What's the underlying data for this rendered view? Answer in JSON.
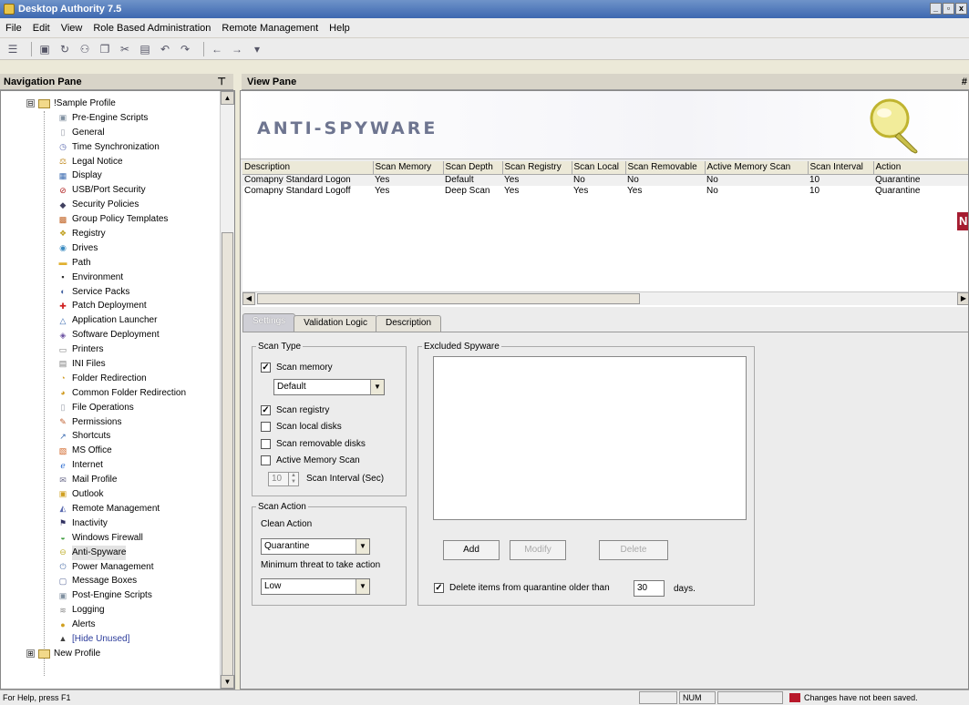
{
  "window": {
    "title": "Desktop Authority 7.5",
    "controls": [
      "_",
      "▫",
      "x"
    ]
  },
  "menu": [
    "File",
    "Edit",
    "View",
    "Role Based Administration",
    "Remote Management",
    "Help"
  ],
  "toolbar": {
    "icons": [
      "properties-icon",
      "save-icon",
      "refresh-icon",
      "users-icon",
      "copy-icon",
      "cut-icon",
      "paste-icon",
      "undo-icon",
      "redo-icon",
      "back-icon",
      "forward-icon"
    ]
  },
  "nav": {
    "header": "Navigation Pane",
    "pin": "⊤",
    "root": {
      "expander": "⊟",
      "label": "!Sample Profile"
    },
    "items": [
      {
        "label": "Pre-Engine Scripts",
        "icon": "script-icon",
        "glyph": "▣",
        "color": "#8090a0"
      },
      {
        "label": "General",
        "icon": "general-icon",
        "glyph": "▯",
        "color": "#9aa0aa"
      },
      {
        "label": "Time Synchronization",
        "icon": "clock-icon",
        "glyph": "◷",
        "color": "#5a6ab0"
      },
      {
        "label": "Legal Notice",
        "icon": "legal-icon",
        "glyph": "⚖",
        "color": "#c08a20"
      },
      {
        "label": "Display",
        "icon": "display-icon",
        "glyph": "▦",
        "color": "#3a6ab0"
      },
      {
        "label": "USB/Port Security",
        "icon": "usb-security-icon",
        "glyph": "⊘",
        "color": "#b02020"
      },
      {
        "label": "Security Policies",
        "icon": "security-policies-icon",
        "glyph": "◆",
        "color": "#404060"
      },
      {
        "label": "Group Policy Templates",
        "icon": "group-policy-icon",
        "glyph": "▩",
        "color": "#c06020"
      },
      {
        "label": "Registry",
        "icon": "registry-icon",
        "glyph": "❖",
        "color": "#c0a020"
      },
      {
        "label": "Drives",
        "icon": "drives-icon",
        "glyph": "◉",
        "color": "#3a8ac0"
      },
      {
        "label": "Path",
        "icon": "path-icon",
        "glyph": "▬",
        "color": "#e0b030"
      },
      {
        "label": "Environment",
        "icon": "environment-icon",
        "glyph": "▪",
        "color": "#303030"
      },
      {
        "label": "Service Packs",
        "icon": "service-packs-icon",
        "glyph": "◐",
        "color": "#4060a0"
      },
      {
        "label": "Patch Deployment",
        "icon": "patch-icon",
        "glyph": "✚",
        "color": "#d02020"
      },
      {
        "label": "Application Launcher",
        "icon": "launcher-icon",
        "glyph": "△",
        "color": "#3a6ab0"
      },
      {
        "label": "Software Deployment",
        "icon": "software-icon",
        "glyph": "◈",
        "color": "#6a50a0"
      },
      {
        "label": "Printers",
        "icon": "printer-icon",
        "glyph": "▭",
        "color": "#7a7a7a"
      },
      {
        "label": "INI Files",
        "icon": "ini-icon",
        "glyph": "▤",
        "color": "#7a7a7a"
      },
      {
        "label": "Folder Redirection",
        "icon": "folder-redirection-icon",
        "glyph": "◔",
        "color": "#d09a20"
      },
      {
        "label": "Common Folder Redirection",
        "icon": "common-folder-icon",
        "glyph": "◕",
        "color": "#d09a20"
      },
      {
        "label": "File Operations",
        "icon": "file-operations-icon",
        "glyph": "▯",
        "color": "#9aa0aa"
      },
      {
        "label": "Permissions",
        "icon": "permissions-icon",
        "glyph": "✎",
        "color": "#c06030"
      },
      {
        "label": "Shortcuts",
        "icon": "shortcuts-icon",
        "glyph": "↗",
        "color": "#3a6ab0"
      },
      {
        "label": "MS Office",
        "icon": "office-icon",
        "glyph": "▧",
        "color": "#d06020"
      },
      {
        "label": "Internet",
        "icon": "internet-icon",
        "glyph": "ℯ",
        "color": "#2a6ad0"
      },
      {
        "label": "Mail Profile",
        "icon": "mail-profile-icon",
        "glyph": "✉",
        "color": "#6a6a8a"
      },
      {
        "label": "Outlook",
        "icon": "outlook-icon",
        "glyph": "▣",
        "color": "#d0a020"
      },
      {
        "label": "Remote Management",
        "icon": "remote-management-icon",
        "glyph": "◭",
        "color": "#5a6ab0"
      },
      {
        "label": "Inactivity",
        "icon": "inactivity-icon",
        "glyph": "⚑",
        "color": "#303060"
      },
      {
        "label": "Windows Firewall",
        "icon": "firewall-icon",
        "glyph": "◒",
        "color": "#3a9a3a"
      },
      {
        "label": "Anti-Spyware",
        "icon": "anti-spyware-icon",
        "glyph": "⊖",
        "color": "#c0b030",
        "selected": true
      },
      {
        "label": "Power Management",
        "icon": "power-icon",
        "glyph": "⏻",
        "color": "#5a7ab0"
      },
      {
        "label": "Message Boxes",
        "icon": "message-boxes-icon",
        "glyph": "▢",
        "color": "#5a6a9a"
      },
      {
        "label": "Post-Engine Scripts",
        "icon": "script-icon",
        "glyph": "▣",
        "color": "#8090a0"
      },
      {
        "label": "Logging",
        "icon": "logging-icon",
        "glyph": "≋",
        "color": "#8a8a8a"
      },
      {
        "label": "Alerts",
        "icon": "alerts-icon",
        "glyph": "●",
        "color": "#d0a020"
      },
      {
        "label": "[Hide Unused]",
        "icon": "hide-unused-icon",
        "glyph": "▲",
        "color": "#404040",
        "blue": true
      }
    ],
    "second_root": {
      "expander": "⊞",
      "label": "New Profile"
    }
  },
  "view": {
    "header": "View Pane",
    "pin": "#",
    "banner_title": "ANTI-SPYWARE",
    "grid": {
      "columns": [
        "Description",
        "Scan Memory",
        "Scan Depth",
        "Scan Registry",
        "Scan Local",
        "Scan Removable",
        "Active Memory Scan",
        "Scan Interval",
        "Action"
      ],
      "rows": [
        [
          "Comapny Standard Logon",
          "Yes",
          "Default",
          "Yes",
          "No",
          "No",
          "No",
          "10",
          "Quarantine"
        ],
        [
          "Comapny Standard Logoff",
          "Yes",
          "Deep Scan",
          "Yes",
          "Yes",
          "Yes",
          "No",
          "10",
          "Quarantine"
        ]
      ]
    },
    "badge": "N",
    "tabs": [
      "Settings",
      "Validation Logic",
      "Description"
    ],
    "scan_type": {
      "legend": "Scan Type",
      "scan_memory": {
        "label": "Scan memory",
        "checked": "✓"
      },
      "depth_value": "Default",
      "scan_registry": {
        "label": "Scan registry",
        "checked": "✓"
      },
      "scan_local": {
        "label": "Scan local disks",
        "checked": ""
      },
      "scan_removable": {
        "label": "Scan removable disks",
        "checked": ""
      },
      "active_memory": {
        "label": "Active Memory Scan",
        "checked": ""
      },
      "interval_value": "10",
      "interval_label": "Scan Interval (Sec)"
    },
    "scan_action": {
      "legend": "Scan Action",
      "clean_label": "Clean Action",
      "clean_value": "Quarantine",
      "threat_label": "Minimum threat to take action",
      "threat_value": "Low"
    },
    "excluded": {
      "legend": "Excluded Spyware",
      "add": "Add",
      "modify": "Modify",
      "delete": "Delete",
      "delete_older_label": "Delete items from quarantine older than",
      "delete_older_checked": "✓",
      "days_value": "30",
      "days_label": "days."
    }
  },
  "status": {
    "help": "For Help, press F1",
    "num": "NUM",
    "message": "Changes have not been saved."
  }
}
